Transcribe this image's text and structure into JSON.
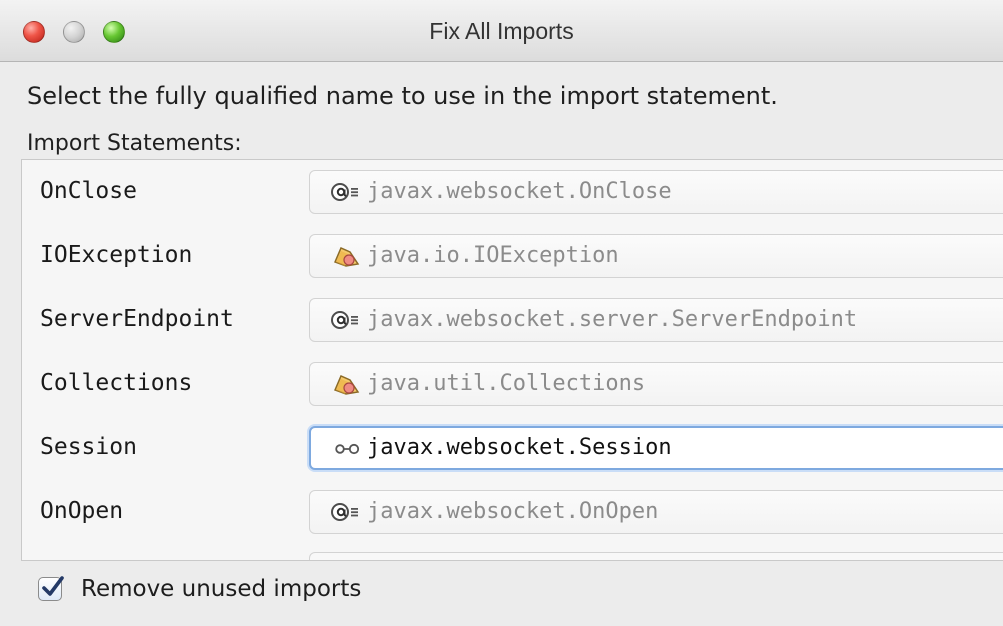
{
  "window": {
    "title": "Fix All Imports",
    "controls": {
      "close": "close-button",
      "minimize": "minimize-button",
      "zoom": "zoom-button"
    }
  },
  "dialog": {
    "instruction": "Select the fully qualified name to use in the import statement.",
    "import_statements_label": "Import Statements:",
    "imports": [
      {
        "class_name": "OnClose",
        "qualified_name": "javax.websocket.OnClose",
        "icon": "annotation-icon",
        "selected": false
      },
      {
        "class_name": "IOException",
        "qualified_name": "java.io.IOException",
        "icon": "class-icon",
        "selected": false
      },
      {
        "class_name": "ServerEndpoint",
        "qualified_name": "javax.websocket.server.ServerEndpoint",
        "icon": "annotation-icon",
        "selected": false
      },
      {
        "class_name": "Collections",
        "qualified_name": "java.util.Collections",
        "icon": "class-icon",
        "selected": false
      },
      {
        "class_name": "Session",
        "qualified_name": "javax.websocket.Session",
        "icon": "interface-icon",
        "selected": true
      },
      {
        "class_name": "OnOpen",
        "qualified_name": "javax.websocket.OnOpen",
        "icon": "annotation-icon",
        "selected": false
      }
    ],
    "remove_unused_imports": {
      "label": "Remove unused imports",
      "checked": true
    }
  },
  "colors": {
    "window_background": "#ececec",
    "selected_border": "#7ea9df",
    "inactive_text": "#8b8b8b",
    "checkbox_check": "#243a67"
  }
}
